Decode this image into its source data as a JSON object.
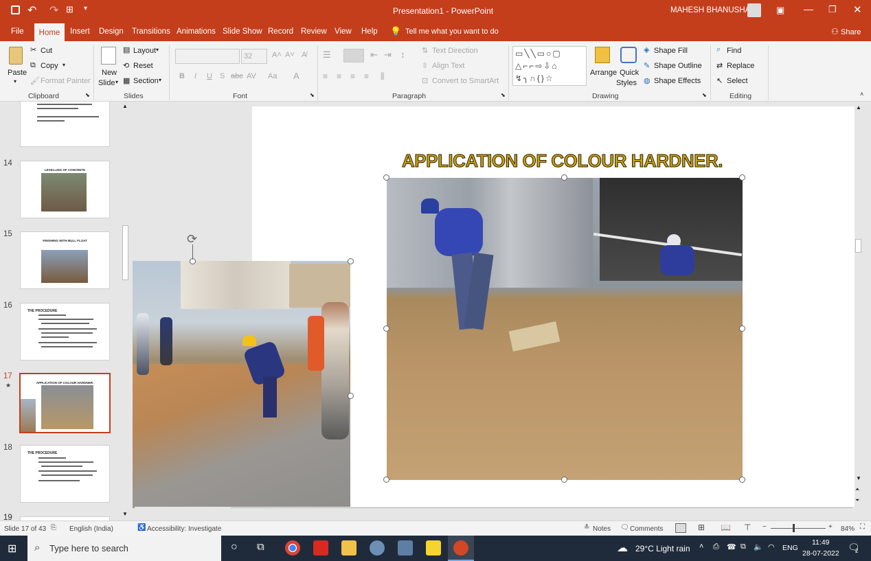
{
  "window": {
    "title": "Presentation1 - PowerPoint",
    "user": "MAHESH BHANUSHALI"
  },
  "menu": {
    "tabs": [
      "File",
      "Home",
      "Insert",
      "Design",
      "Transitions",
      "Animations",
      "Slide Show",
      "Record",
      "Review",
      "View",
      "Help"
    ],
    "tell_me": "Tell me what you want to do",
    "share": "Share"
  },
  "ribbon": {
    "clipboard": {
      "label": "Clipboard",
      "paste": "Paste",
      "cut": "Cut",
      "copy": "Copy",
      "format_painter": "Format Painter"
    },
    "slides": {
      "label": "Slides",
      "new_slide_1": "New",
      "new_slide_2": "Slide",
      "layout": "Layout",
      "reset": "Reset",
      "section": "Section"
    },
    "font": {
      "label": "Font",
      "size": "32"
    },
    "paragraph": {
      "label": "Paragraph",
      "text_direction": "Text Direction",
      "align_text": "Align Text",
      "smartart": "Convert to SmartArt"
    },
    "drawing": {
      "label": "Drawing",
      "arrange": "Arrange",
      "quick_styles_1": "Quick",
      "quick_styles_2": "Styles",
      "shape_fill": "Shape Fill",
      "shape_outline": "Shape Outline",
      "shape_effects": "Shape Effects"
    },
    "editing": {
      "label": "Editing",
      "find": "Find",
      "replace": "Replace",
      "select": "Select"
    }
  },
  "thumbnails": [
    {
      "num": "14",
      "title": "LEVELLING OF CONCRETE"
    },
    {
      "num": "15",
      "title": "FINISHING WITH BULL FLOAT"
    },
    {
      "num": "16",
      "title": "THE PROCEDURE"
    },
    {
      "num": "17",
      "title": "APPLICATION OF COLOUR HARDNER."
    },
    {
      "num": "18",
      "title": "THE PROCEDURE"
    },
    {
      "num": "19",
      "title": ""
    }
  ],
  "slide": {
    "title": "APPLICATION OF COLOUR HARDNER."
  },
  "status": {
    "slide_of": "Slide 17 of 43",
    "language": "English (India)",
    "accessibility": "Accessibility: Investigate",
    "notes": "Notes",
    "comments": "Comments",
    "zoom": "84%"
  },
  "taskbar": {
    "search_placeholder": "Type here to search",
    "weather": "29°C  Light rain",
    "lang": "ENG",
    "time": "11:49",
    "date": "28-07-2022",
    "notifications": "2"
  },
  "colors": {
    "accent": "#c43e1c",
    "title_fill": "#c8a017"
  }
}
